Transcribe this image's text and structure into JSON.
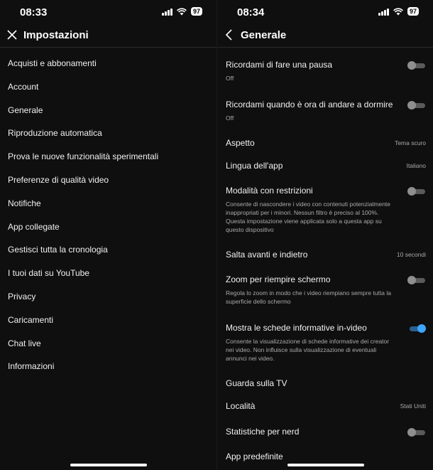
{
  "left": {
    "time": "08:33",
    "battery": "97",
    "title": "Impostazioni",
    "menu": [
      "Acquisti e abbonamenti",
      "Account",
      "Generale",
      "Riproduzione automatica",
      "Prova le nuove funzionalità sperimentali",
      "Preferenze di qualità video",
      "Notifiche",
      "App collegate",
      "Gestisci tutta la cronologia",
      "I tuoi dati su YouTube",
      "Privacy",
      "Caricamenti",
      "Chat live",
      "Informazioni"
    ]
  },
  "right": {
    "time": "08:34",
    "battery": "97",
    "title": "Generale",
    "settings": {
      "pausa": {
        "title": "Ricordami di fare una pausa",
        "sub": "Off",
        "toggle": "off"
      },
      "dormire": {
        "title": "Ricordami quando è ora di andare a dormire",
        "sub": "Off",
        "toggle": "off"
      },
      "aspetto": {
        "title": "Aspetto",
        "value": "Tema scuro"
      },
      "lingua": {
        "title": "Lingua dell'app",
        "value": "Italiano"
      },
      "restrizioni": {
        "title": "Modalità con restrizioni",
        "sub": "Consente di nascondere i video con contenuti potenzialmente inappropriati per i minori. Nessun filtro è preciso al 100%. Questa impostazione viene applicata solo a questa app su questo dispositivo",
        "toggle": "off"
      },
      "salta": {
        "title": "Salta avanti e indietro",
        "value": "10 secondi"
      },
      "zoom": {
        "title": "Zoom per riempire schermo",
        "sub": "Regola lo zoom in modo che i video riempiano sempre tutta la superficie dello schermo",
        "toggle": "off"
      },
      "schede": {
        "title": "Mostra le schede informative in-video",
        "sub": "Consente la visualizzazione di schede informative dei creator nei video. Non influisce sulla visualizzazione di eventuali annunci nei video.",
        "toggle": "on"
      },
      "tv": {
        "title": "Guarda sulla TV"
      },
      "localita": {
        "title": "Località",
        "value": "Stati Uniti"
      },
      "nerd": {
        "title": "Statistiche per nerd",
        "toggle": "off"
      },
      "predefinite": {
        "title": "App predefinite"
      }
    }
  },
  "colors": {
    "background": "#0f0f0f",
    "accent": "#3ea6ff",
    "text": "#f1f1f1",
    "muted": "#aaaaaa"
  }
}
